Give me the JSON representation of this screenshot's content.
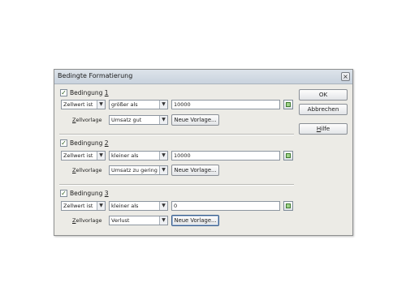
{
  "dialog": {
    "title": "Bedingte Formatierung",
    "close_glyph": "×"
  },
  "conditions": [
    {
      "label_prefix": "Bedingung ",
      "label_number": "1",
      "checked": true,
      "type_value": "Zellwert ist",
      "operator_value": "größer als",
      "value": "10000",
      "style_label_prefix": "",
      "style_label_mnemonic": "Z",
      "style_label_rest": "ellvorlage",
      "style_value": "Umsatz gut",
      "new_style_label": "Neue Vorlage..."
    },
    {
      "label_prefix": "Bedingung ",
      "label_number": "2",
      "checked": true,
      "type_value": "Zellwert ist",
      "operator_value": "kleiner als",
      "value": "10000",
      "style_label_prefix": "",
      "style_label_mnemonic": "Z",
      "style_label_rest": "ellvorlage",
      "style_value": "Umsatz zu gering",
      "new_style_label": "Neue Vorlage..."
    },
    {
      "label_prefix": "Bedingung ",
      "label_number": "3",
      "checked": true,
      "type_value": "Zellwert ist",
      "operator_value": "kleiner als",
      "value": "0",
      "style_label_prefix": "",
      "style_label_mnemonic": "Z",
      "style_label_rest": "ellvorlage",
      "style_value": "Verlust",
      "new_style_label": "Neue Vorlage..."
    }
  ],
  "buttons": {
    "ok": "OK",
    "cancel": "Abbrechen",
    "help_mnemonic": "H",
    "help_rest": "ilfe"
  },
  "glyphs": {
    "check": "✓",
    "dropdown": "▼"
  },
  "icons": {
    "shrink": "shrink-icon"
  }
}
